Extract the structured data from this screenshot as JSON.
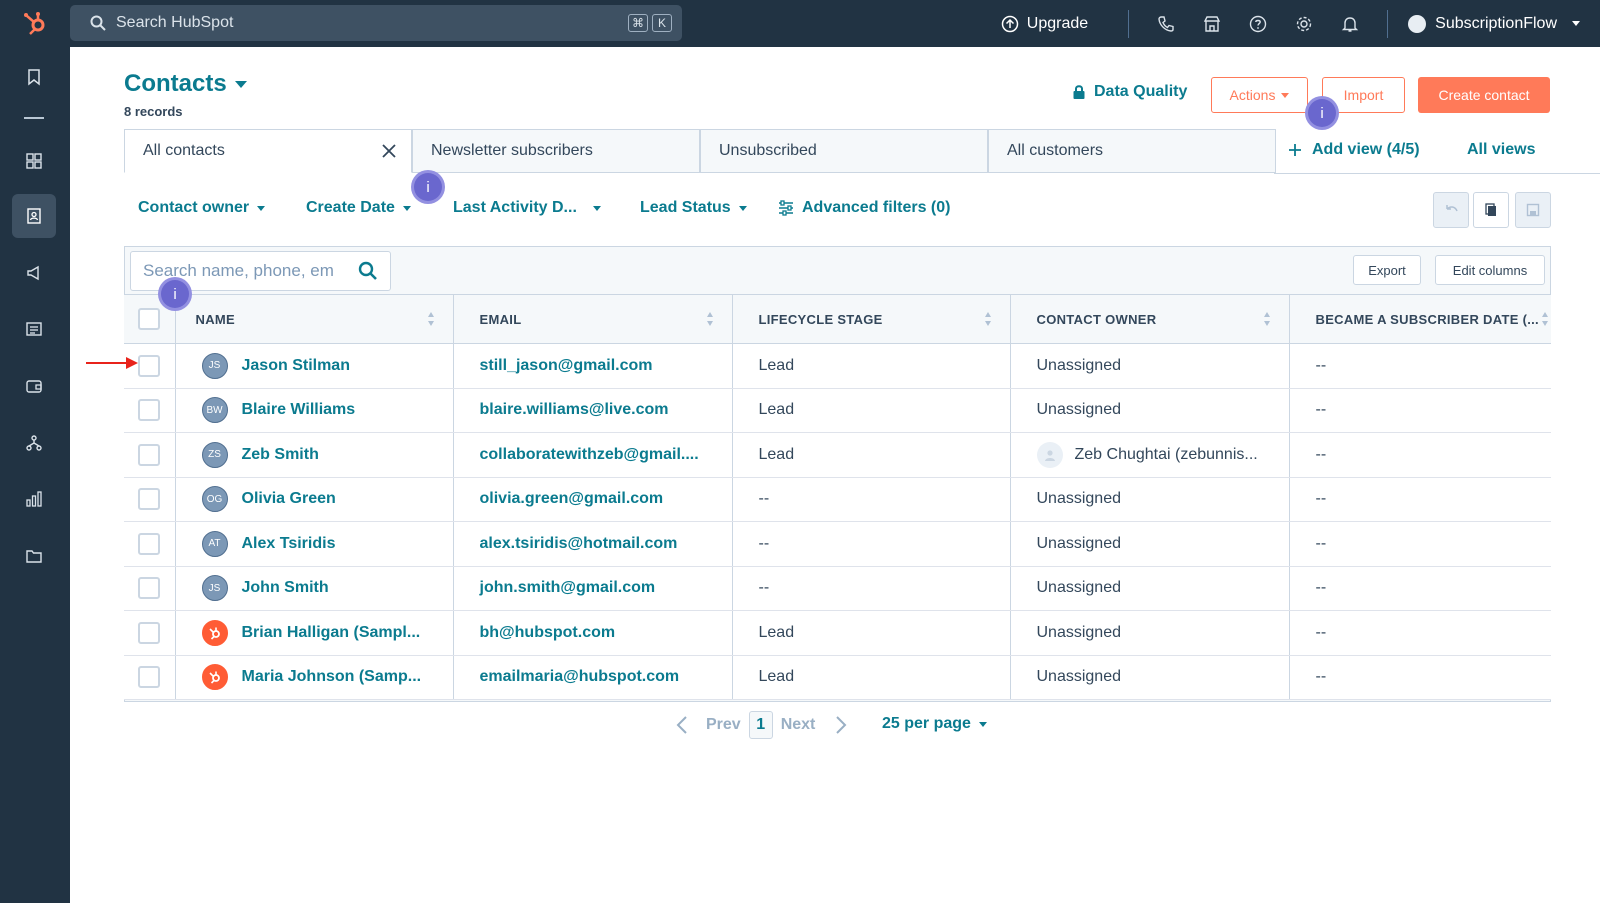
{
  "topbar": {
    "search_placeholder": "Search HubSpot",
    "shortcut_keys": [
      "⌘",
      "K"
    ],
    "upgrade_label": "Upgrade",
    "account_name": "SubscriptionFlow"
  },
  "header": {
    "title": "Contacts",
    "record_count": "8 records",
    "data_quality_label": "Data Quality",
    "actions_label": "Actions",
    "import_label": "Import",
    "create_label": "Create contact"
  },
  "tabs": [
    {
      "label": "All contacts"
    },
    {
      "label": "Newsletter subscribers"
    },
    {
      "label": "Unsubscribed"
    },
    {
      "label": "All customers"
    }
  ],
  "views": {
    "add_view_label": "Add view (4/5)",
    "all_views_label": "All views"
  },
  "filters": {
    "contact_owner": "Contact owner",
    "create_date": "Create Date",
    "last_activity": "Last Activity D...",
    "lead_status": "Lead Status",
    "advanced": "Advanced filters (0)"
  },
  "table": {
    "search_placeholder": "Search name, phone, em",
    "export_label": "Export",
    "edit_columns_label": "Edit columns",
    "columns": [
      "NAME",
      "EMAIL",
      "LIFECYCLE STAGE",
      "CONTACT OWNER",
      "BECAME A SUBSCRIBER DATE (..."
    ],
    "rows": [
      {
        "initials": "JS",
        "name": "Jason Stilman",
        "email": "still_jason@gmail.com",
        "stage": "Lead",
        "owner": "Unassigned",
        "subscriber_date": "--"
      },
      {
        "initials": "BW",
        "name": "Blaire Williams",
        "email": "blaire.williams@live.com",
        "stage": "Lead",
        "owner": "Unassigned",
        "subscriber_date": "--"
      },
      {
        "initials": "ZS",
        "name": "Zeb Smith",
        "email": "collaboratewithzeb@gmail....",
        "stage": "Lead",
        "owner": "Zeb Chughtai (zebunnis...",
        "subscriber_date": "--"
      },
      {
        "initials": "OG",
        "name": "Olivia Green",
        "email": "olivia.green@gmail.com",
        "stage": "--",
        "owner": "Unassigned",
        "subscriber_date": "--"
      },
      {
        "initials": "AT",
        "name": "Alex Tsiridis",
        "email": "alex.tsiridis@hotmail.com",
        "stage": "--",
        "owner": "Unassigned",
        "subscriber_date": "--"
      },
      {
        "initials": "JS",
        "name": "John Smith",
        "email": "john.smith@gmail.com",
        "stage": "--",
        "owner": "Unassigned",
        "subscriber_date": "--"
      },
      {
        "initials": "",
        "name": "Brian Halligan (Sampl...",
        "email": "bh@hubspot.com",
        "stage": "Lead",
        "owner": "Unassigned",
        "subscriber_date": "--"
      },
      {
        "initials": "",
        "name": "Maria Johnson (Samp...",
        "email": "emailmaria@hubspot.com",
        "stage": "Lead",
        "owner": "Unassigned",
        "subscriber_date": "--"
      }
    ]
  },
  "pagination": {
    "prev_label": "Prev",
    "current_page": "1",
    "next_label": "Next",
    "per_page_label": "25 per page"
  },
  "annotations": {
    "info_marker": "i"
  },
  "colors": {
    "nav_bg": "#213343",
    "accent_teal": "#0b7b8f",
    "accent_orange": "#ff7a59",
    "info_purple": "#6a67ce",
    "arrow_red": "#e8231b"
  }
}
